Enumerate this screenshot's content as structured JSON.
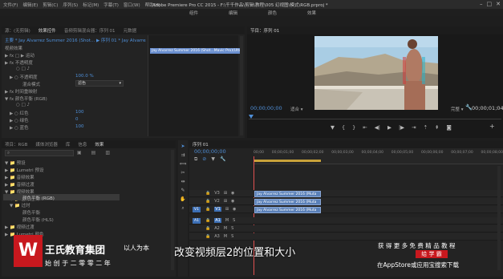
{
  "titlebar": {
    "menu": [
      "文件(F)",
      "编辑(E)",
      "剪辑(C)",
      "序列(S)",
      "标记(M)",
      "字幕(T)",
      "窗口(W)",
      "帮助(H)"
    ],
    "title": "Adobe Premiere Pro CC 2015 - F:\\千千作品\\剪辑\\教程\\005 幻视图\\模式\\RGB.prproj *",
    "workspace_tabs": [
      "组件",
      "编辑",
      "颜色",
      "效果"
    ]
  },
  "effect_controls": {
    "tabs": [
      "源：(无剪辑)",
      "效果控件",
      "音频剪辑混合器：序列 01",
      "元数据"
    ],
    "clip_path": "主要 * Jay Alvarrez Summer 2016 (Shot...  ▶  序列 01 * Jay Alvarrez Summer 2016...",
    "section_label": "视频效果",
    "rows": [
      {
        "label": "▶ fx  □ ▶ 运动",
        "value": ""
      },
      {
        "label": "▶ fx  不透明度",
        "value": ""
      },
      {
        "label": "○ □ ♪",
        "value": ""
      },
      {
        "label": "▶ ○ 不透明度",
        "value": "100.0 %"
      },
      {
        "label": "混合模式",
        "value": "滤色"
      },
      {
        "label": "▶ fx  时间重映射",
        "value": ""
      },
      {
        "label": "▼ fx  颜色平衡 (RGB)",
        "value": ""
      },
      {
        "label": "○ □ ♪",
        "value": ""
      },
      {
        "label": "▶ ○ 红色",
        "value": "100"
      },
      {
        "label": "▶ ○ 绿色",
        "value": "0"
      },
      {
        "label": "▶ ○ 蓝色",
        "value": "100"
      }
    ],
    "clip_label": "Jay Alvarrez Summer 2016 (Shot...Mavic Pro)(Ultra HD.mp4"
  },
  "program_monitor": {
    "tab": "节目：序列 01",
    "timecode_left": "00;00;00;00",
    "fit": "适合",
    "quality": "完整",
    "timecode_right": "00;00;01;04"
  },
  "project": {
    "tabs": [
      "项目：RGB",
      "媒体浏览器",
      "库",
      "信息",
      "效果"
    ],
    "search_placeholder": "",
    "tree": [
      "▼ 📁 预设",
      "▶ 📁 Lumetri 预设",
      "▶ 📁 音频效果",
      "▶ 📁 音频过渡",
      "▼ 📁 视频效果",
      "▼ 📁 图像控制",
      "颜色平衡 (RGB)",
      "▼ 📁 过时",
      "颜色平衡",
      "颜色平衡 (HLS)",
      "▶ 📁 视频过渡",
      "▶ 📁 Lumetri 颜色"
    ]
  },
  "timeline": {
    "tab": "序列 01",
    "timecode": "00;00;00;00",
    "ruler": [
      "00;00",
      "00;00;01;00",
      "00;00;02;00",
      "00;00;03;00",
      "00;00;04;00",
      "00;00;05;00",
      "00;00;06;00",
      "00;00;07;00",
      "00;00;08;00"
    ],
    "tracks": [
      {
        "name": "V3",
        "label": "",
        "clip": "Jay Alvarrez Summer 2016 (Muta"
      },
      {
        "name": "V2",
        "label": "",
        "clip": "Jay Alvarrez Summer 2016 (Muta"
      },
      {
        "name": "V1",
        "label": "V1",
        "clip": "Jay Alvarrez Summer 2016 (Muta"
      },
      {
        "name": "A1",
        "label": "A1",
        "clip": ""
      },
      {
        "name": "A2",
        "label": "",
        "clip": ""
      },
      {
        "name": "A3",
        "label": "",
        "clip": ""
      }
    ]
  },
  "watermark": {
    "logo_name": "王氏教育集团",
    "tagline": "以人为本",
    "subline": "始 创 于 二 零 零 二 年",
    "caption": "改变视频层2的位置和大小",
    "promo_top": "获 得 更 多 免 费 精 品 教 程",
    "promo_badge": "给 学 霸",
    "promo_bottom": "在AppStore或应用宝搜索下载"
  },
  "colors": {
    "accent": "#4f8fd8",
    "clip": "#5a80b8",
    "playhead": "#e05050",
    "logo_red": "#c8181e",
    "caption": "#ffffff"
  }
}
